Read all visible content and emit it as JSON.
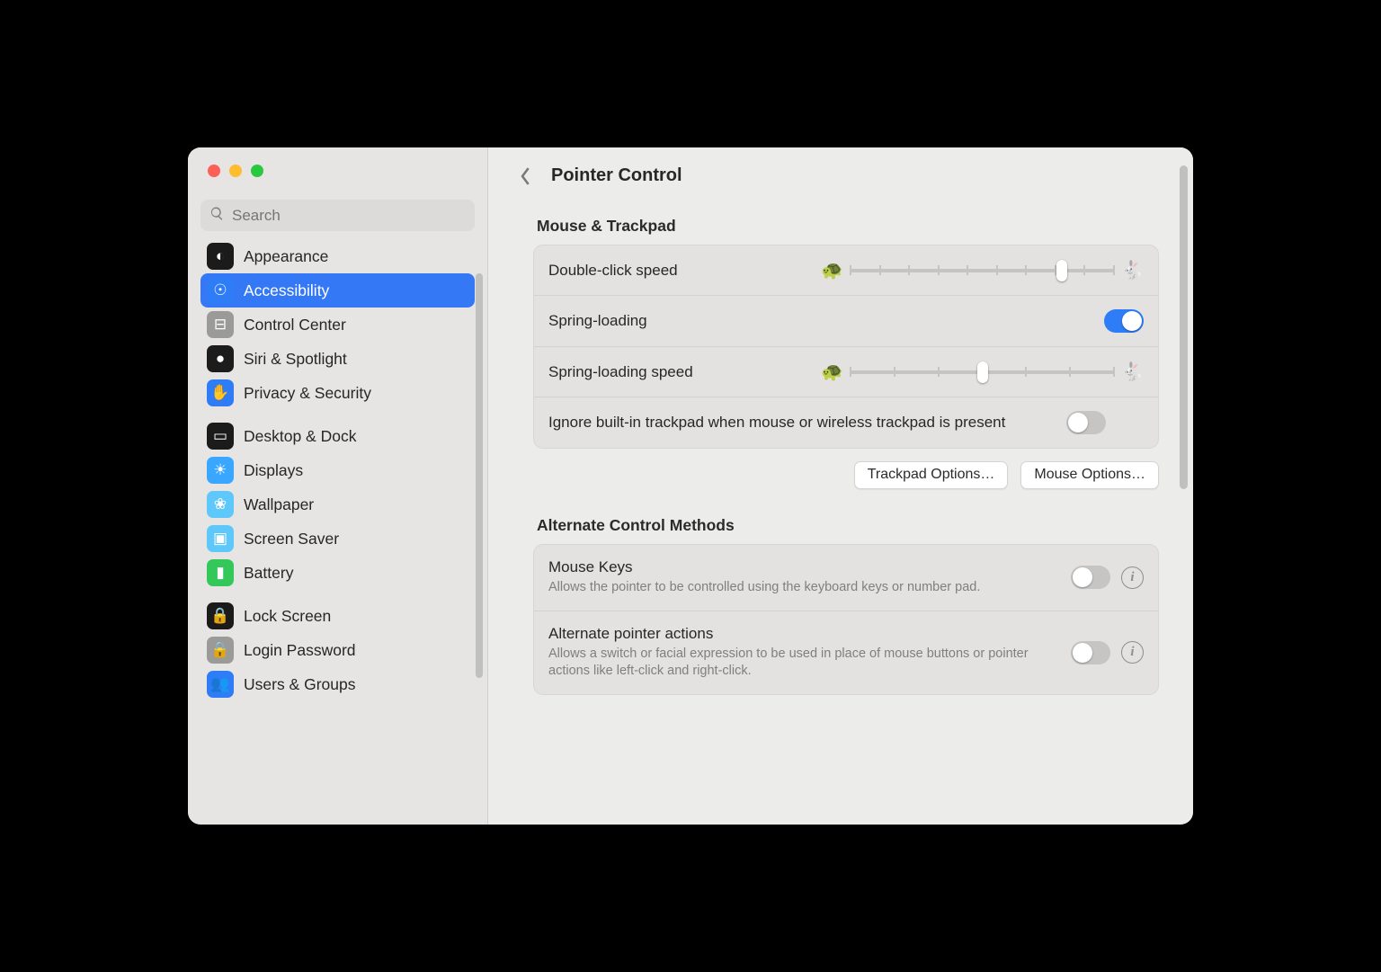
{
  "search": {
    "placeholder": "Search"
  },
  "header": {
    "title": "Pointer Control"
  },
  "sidebar": {
    "groups": [
      {
        "items": [
          {
            "label": "Appearance",
            "icon_bg": "#1b1b1b",
            "glyph": "◐",
            "selected": false,
            "key": "appearance"
          },
          {
            "label": "Accessibility",
            "icon_bg": "#2e7cf6",
            "glyph": "☉",
            "selected": true,
            "key": "accessibility"
          },
          {
            "label": "Control Center",
            "icon_bg": "#9a9a99",
            "glyph": "⊟",
            "selected": false,
            "key": "control-center"
          },
          {
            "label": "Siri & Spotlight",
            "icon_bg": "#1c1c1c",
            "glyph": "●",
            "selected": false,
            "key": "siri"
          },
          {
            "label": "Privacy & Security",
            "icon_bg": "#2e7cf6",
            "glyph": "✋",
            "selected": false,
            "key": "privacy"
          }
        ]
      },
      {
        "items": [
          {
            "label": "Desktop & Dock",
            "icon_bg": "#1b1b1b",
            "glyph": "▭",
            "selected": false,
            "key": "desktop-dock"
          },
          {
            "label": "Displays",
            "icon_bg": "#39a7ff",
            "glyph": "☀",
            "selected": false,
            "key": "displays"
          },
          {
            "label": "Wallpaper",
            "icon_bg": "#5ec8fa",
            "glyph": "❀",
            "selected": false,
            "key": "wallpaper"
          },
          {
            "label": "Screen Saver",
            "icon_bg": "#5ec8fa",
            "glyph": "▣",
            "selected": false,
            "key": "screen-saver"
          },
          {
            "label": "Battery",
            "icon_bg": "#34c759",
            "glyph": "▮",
            "selected": false,
            "key": "battery"
          }
        ]
      },
      {
        "items": [
          {
            "label": "Lock Screen",
            "icon_bg": "#1b1b1b",
            "glyph": "🔒",
            "selected": false,
            "key": "lock-screen"
          },
          {
            "label": "Login Password",
            "icon_bg": "#9a9a99",
            "glyph": "🔒",
            "selected": false,
            "key": "login-password"
          },
          {
            "label": "Users & Groups",
            "icon_bg": "#2e7cf6",
            "glyph": "👥",
            "selected": false,
            "key": "users-groups"
          }
        ]
      }
    ]
  },
  "sections": {
    "mouse_trackpad": {
      "title": "Mouse & Trackpad",
      "rows": {
        "double_click": {
          "label": "Double-click speed",
          "slider_percent": 80,
          "ticks": 10
        },
        "spring_loading": {
          "label": "Spring-loading",
          "on": true
        },
        "spring_loading_speed": {
          "label": "Spring-loading speed",
          "slider_percent": 50,
          "ticks": 7
        },
        "ignore_trackpad": {
          "label": "Ignore built-in trackpad when mouse or wireless trackpad is present",
          "on": false
        }
      },
      "buttons": {
        "trackpad": "Trackpad Options…",
        "mouse": "Mouse Options…"
      }
    },
    "alternate": {
      "title": "Alternate Control Methods",
      "rows": {
        "mouse_keys": {
          "label": "Mouse Keys",
          "desc": "Allows the pointer to be controlled using the keyboard keys or number pad.",
          "on": false
        },
        "alt_pointer": {
          "label": "Alternate pointer actions",
          "desc": "Allows a switch or facial expression to be used in place of mouse buttons or pointer actions like left-click and right-click.",
          "on": false
        }
      }
    }
  }
}
